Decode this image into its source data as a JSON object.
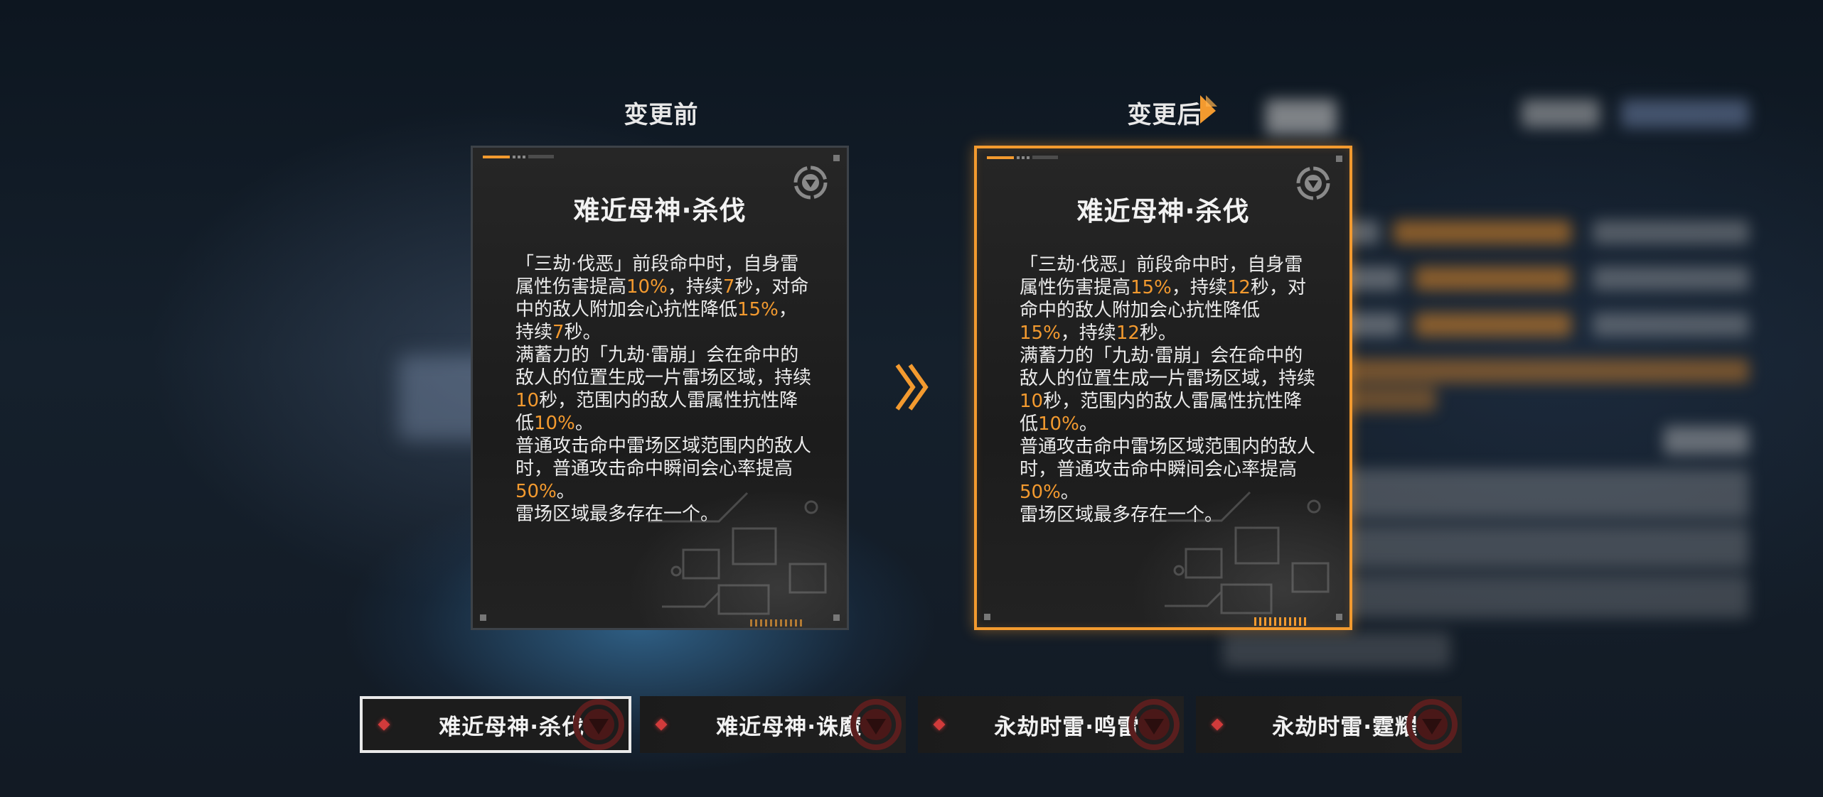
{
  "headings": {
    "before": "变更前",
    "after": "变更后"
  },
  "cards": {
    "before": {
      "title": "难近母神·杀伐",
      "paragraphs": [
        [
          {
            "t": "「三劫·伐恶」前段命中时，自身雷属性伤害提高"
          },
          {
            "t": "10%",
            "hl": true
          },
          {
            "t": "，持续"
          },
          {
            "t": "7",
            "hl": true
          },
          {
            "t": "秒，对命中的敌人附加会心抗性降低"
          },
          {
            "t": "15%",
            "hl": true
          },
          {
            "t": "，持续"
          },
          {
            "t": "7",
            "hl": true
          },
          {
            "t": "秒。"
          }
        ],
        [
          {
            "t": "满蓄力的「九劫·雷崩」会在命中的敌人的位置生成一片雷场区域，持续"
          },
          {
            "t": "10",
            "hl": true
          },
          {
            "t": "秒，范围内的敌人雷属性抗性降低"
          },
          {
            "t": "10%",
            "hl": true
          },
          {
            "t": "。"
          }
        ],
        [
          {
            "t": "普通攻击命中雷场区域范围内的敌人时，普通攻击命中瞬间会心率提高"
          },
          {
            "t": "50%",
            "hl": true
          },
          {
            "t": "。"
          }
        ],
        [
          {
            "t": "雷场区域最多存在一个。"
          }
        ]
      ]
    },
    "after": {
      "title": "难近母神·杀伐",
      "paragraphs": [
        [
          {
            "t": "「三劫·伐恶」前段命中时，自身雷属性伤害提高"
          },
          {
            "t": "15%",
            "hl": true
          },
          {
            "t": "，持续"
          },
          {
            "t": "12",
            "hl": true
          },
          {
            "t": "秒，对命中的敌人附加会心抗性降低"
          },
          {
            "t": "15%",
            "hl": true
          },
          {
            "t": "，持续"
          },
          {
            "t": "12",
            "hl": true
          },
          {
            "t": "秒。"
          }
        ],
        [
          {
            "t": "满蓄力的「九劫·雷崩」会在命中的敌人的位置生成一片雷场区域，持续"
          },
          {
            "t": "10",
            "hl": true
          },
          {
            "t": "秒，范围内的敌人雷属性抗性降低"
          },
          {
            "t": "10%",
            "hl": true
          },
          {
            "t": "。"
          }
        ],
        [
          {
            "t": "普通攻击命中雷场区域范围内的敌人时，普通攻击命中瞬间会心率提高"
          },
          {
            "t": "50%",
            "hl": true
          },
          {
            "t": "。"
          }
        ],
        [
          {
            "t": "雷场区域最多存在一个。"
          }
        ]
      ]
    }
  },
  "tabs": [
    {
      "label": "难近母神·杀伐",
      "selected": true
    },
    {
      "label": "难近母神·诛魔",
      "selected": false
    },
    {
      "label": "永劫时雷·鸣雷",
      "selected": false
    },
    {
      "label": "永劫时雷·霆耀",
      "selected": false
    }
  ],
  "colors": {
    "accent": "#f39a2f",
    "selected_tab_border": "#e9e9e9",
    "diamond": "#d13b3b"
  },
  "icons": {
    "card_emblem": "triangle-emblem-icon",
    "change_arrow": "double-chevron-right-icon",
    "tab_icon": "triangle-emblem-icon"
  }
}
